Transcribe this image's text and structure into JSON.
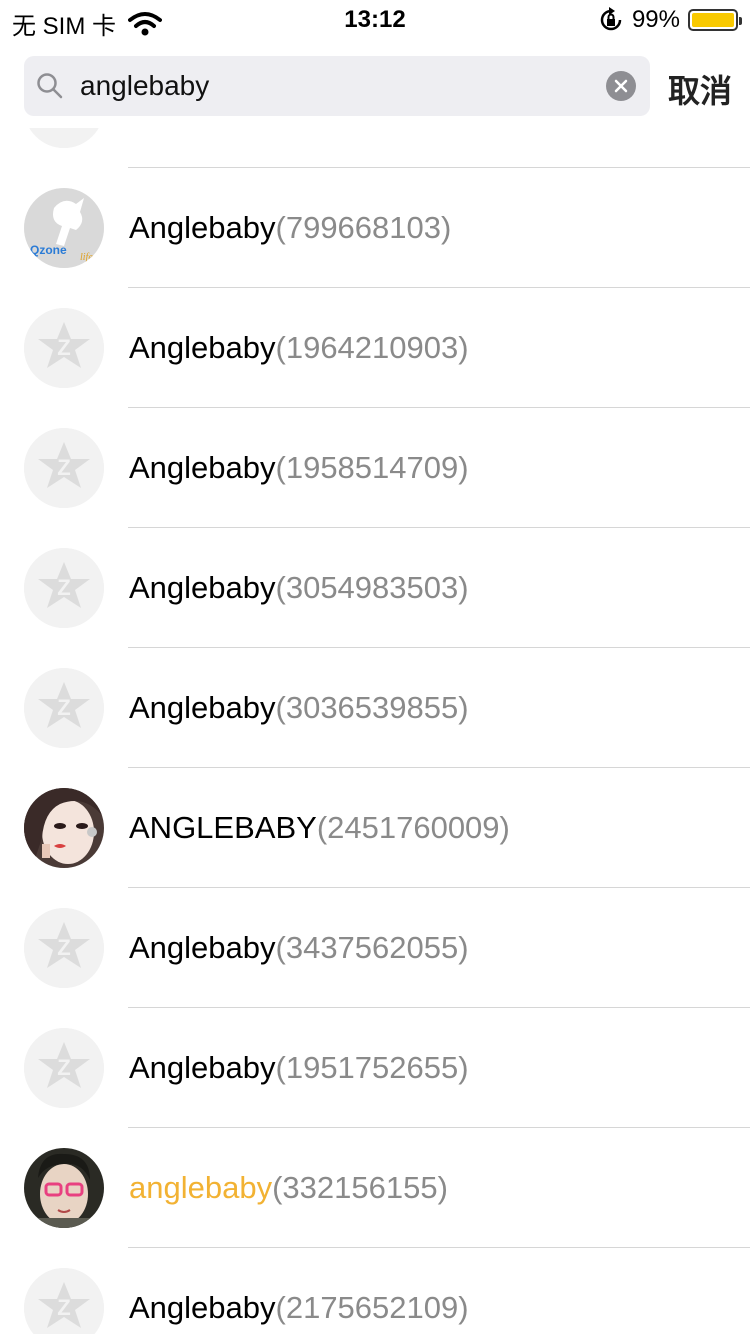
{
  "status": {
    "carrier": "无 SIM 卡",
    "time": "13:12",
    "battery": "99%",
    "battery_level": 0.99,
    "battery_color": "#f9c900"
  },
  "search": {
    "value": "anglebaby",
    "placeholder": "",
    "cancel_label": "取消"
  },
  "colors": {
    "highlight": "#f2b233",
    "qq_gray": "#8a8a8a"
  },
  "results": [
    {
      "name": "Anglebaby",
      "qq": "(799668103)",
      "avatar": "qzone-logo",
      "highlight": false
    },
    {
      "name": "Anglebaby",
      "qq": "(1964210903)",
      "avatar": "default-qzone-icon",
      "highlight": false
    },
    {
      "name": "Anglebaby",
      "qq": "(1958514709)",
      "avatar": "default-qzone-icon",
      "highlight": false
    },
    {
      "name": "Anglebaby",
      "qq": "(3054983503)",
      "avatar": "default-qzone-icon",
      "highlight": false
    },
    {
      "name": "Anglebaby",
      "qq": "(3036539855)",
      "avatar": "default-qzone-icon",
      "highlight": false
    },
    {
      "name": "ANGLEBABY",
      "qq": "(2451760009)",
      "avatar": "photo-woman",
      "highlight": false
    },
    {
      "name": "Anglebaby",
      "qq": "(3437562055)",
      "avatar": "default-qzone-icon",
      "highlight": false
    },
    {
      "name": "Anglebaby",
      "qq": "(1951752655)",
      "avatar": "default-qzone-icon",
      "highlight": false
    },
    {
      "name": "anglebaby",
      "qq": "(332156155)",
      "avatar": "photo-woman-glasses",
      "highlight": true
    },
    {
      "name": "Anglebaby",
      "qq": "(2175652109)",
      "avatar": "default-qzone-icon",
      "highlight": false
    }
  ]
}
